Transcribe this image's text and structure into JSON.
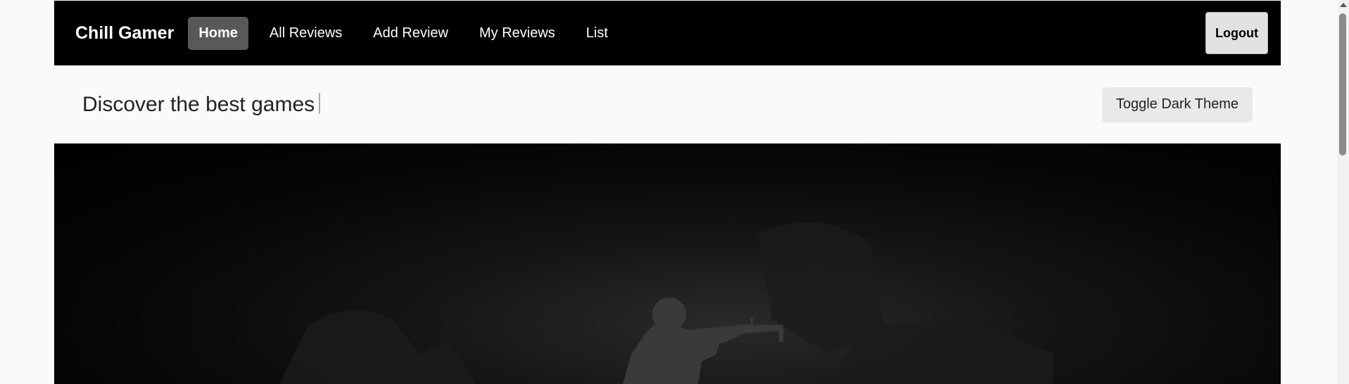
{
  "navbar": {
    "brand": "Chill Gamer",
    "links": [
      {
        "label": "Home",
        "active": true
      },
      {
        "label": "All Reviews"
      },
      {
        "label": "Add Review"
      },
      {
        "label": "My Reviews"
      },
      {
        "label": "List"
      }
    ],
    "logout_label": "Logout"
  },
  "subheader": {
    "tagline": "Discover the best games",
    "toggle_label": "Toggle Dark Theme"
  },
  "hero": {
    "image": "game-banner-soldier-silhouette"
  },
  "colors": {
    "navbar_bg": "#000000",
    "active_link_bg": "#595959",
    "page_bg": "#fafafa"
  }
}
